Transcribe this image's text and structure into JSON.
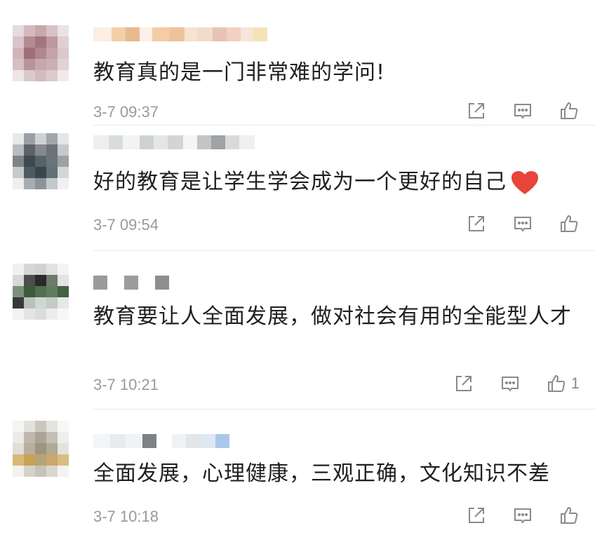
{
  "comments": [
    {
      "text": "教育真的是一门非常难的学问!",
      "time": "3-7 09:37",
      "likes": ""
    },
    {
      "text": "好的教育是让学生学会成为一个更好的自己",
      "emoji": "red-heart-icon",
      "time": "3-7 09:54",
      "likes": ""
    },
    {
      "text": "教育要让人全面发展，做对社会有用的全能型人才",
      "time": "3-7 10:21",
      "likes": "1"
    },
    {
      "text": "全面发展，心理健康，三观正确，文化知识不差",
      "time": "3-7 10:18",
      "likes": ""
    }
  ],
  "icons": {
    "share": "share-icon",
    "reply": "comment-icon",
    "like": "thumbs-up-icon"
  },
  "colors": {
    "text": "#1f1f1f",
    "meta": "#9a9a9a",
    "icon": "#8a8a8a",
    "heart": "#e8443a"
  }
}
